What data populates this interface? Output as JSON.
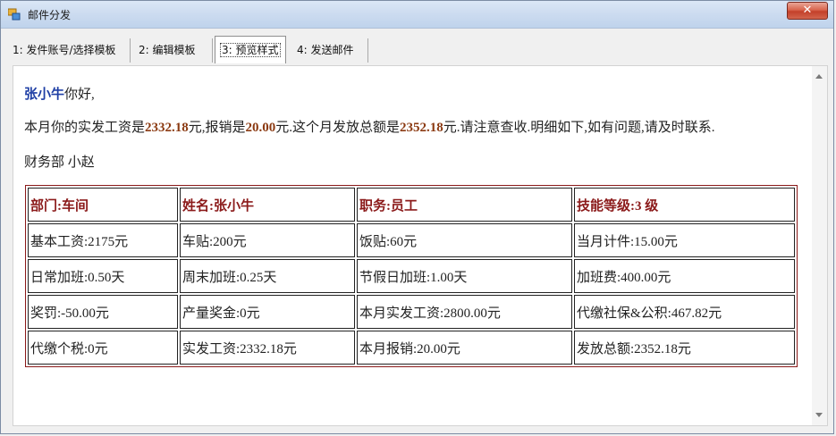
{
  "window": {
    "title": "邮件分发",
    "close_glyph": "✕"
  },
  "tabs": [
    {
      "label": "1: 发件账号/选择模板"
    },
    {
      "label": "2: 编辑模板"
    },
    {
      "label": "3: 预览样式"
    },
    {
      "label": "4: 发送邮件"
    }
  ],
  "preview": {
    "name": "张小牛",
    "greeting_suffix": "你好,",
    "line2": {
      "p1": "本月你的实发工资是",
      "salary": "2332.18",
      "p2": "元,报销是",
      "reimb": "20.00",
      "p3": "元.这个月发放总额是",
      "total": "2352.18",
      "p4": "元.请注意查收.明细如下,如有问题,请及时联系."
    },
    "signature": "财务部 小赵",
    "table": [
      [
        "部门:车间",
        "姓名:张小牛",
        "职务:员工",
        "技能等级:3 级"
      ],
      [
        "基本工资:2175元",
        "车贴:200元",
        "饭贴:60元",
        "当月计件:15.00元"
      ],
      [
        "日常加班:0.50天",
        "周末加班:0.25天",
        "节假日加班:1.00天",
        "加班费:400.00元"
      ],
      [
        "奖罚:-50.00元",
        "产量奖金:0元",
        "本月实发工资:2800.00元",
        "代缴社保&公积:467.82元"
      ],
      [
        "代缴个税:0元",
        "实发工资:2332.18元",
        "本月报销:20.00元",
        "发放总额:2352.18元"
      ]
    ]
  },
  "colors": {
    "accent_name": "#1f3fa5",
    "amount": "#8b3a12",
    "table_header": "#8b1a1a"
  },
  "icons": {
    "app": "mail-app-icon",
    "close": "close-icon",
    "scroll_up": "scroll-up-arrow-icon",
    "scroll_down": "scroll-down-arrow-icon"
  }
}
